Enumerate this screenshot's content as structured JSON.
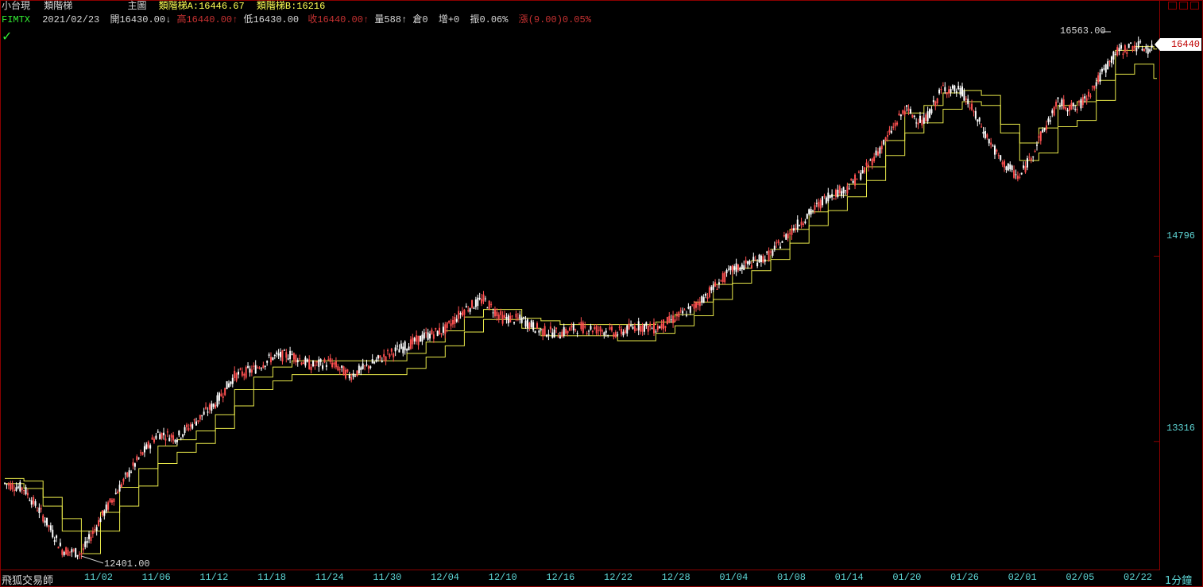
{
  "header": {
    "instrument": "小台現",
    "indicator": "類階梯",
    "panel": "主圖",
    "stairA_label": "類階梯A:",
    "stairA_value": "16446.67",
    "stairB_label": "類階梯B:",
    "stairB_value": "16216"
  },
  "quote": {
    "symbol": "FIMTX",
    "date": "2021/02/23",
    "open_label": "開",
    "open": "16430.00",
    "open_arrow": "↓",
    "high_label": "高",
    "high": "16440.00",
    "high_arrow": "↑",
    "low_label": "低",
    "low": "16430.00",
    "close_label": "收",
    "close": "16440.00",
    "close_arrow": "↑",
    "volume_label": "量",
    "volume": "588",
    "volume_arrow": "↑",
    "oi_label": "倉",
    "oi": "0",
    "oi_change_label": "增",
    "oi_change": "+0",
    "amplitude_label": "振",
    "amplitude": "0.06%",
    "change_label": "漲",
    "change": "(9.00)0.05%"
  },
  "status_icon": "check-icon",
  "price_tag": "16440",
  "footer": {
    "brand": "飛狐交易師",
    "period": "1分鐘"
  },
  "colors": {
    "background": "#000000",
    "border": "#8b0000",
    "stair_line": "#e8e84a",
    "candle_up": "#ffffff",
    "candle_down": "#ff5050",
    "axis_text": "#5fd7d7",
    "header_yellow": "#ffff55",
    "header_green": "#33ee33",
    "header_red": "#c83232"
  },
  "chart_data": {
    "type": "line",
    "title": "",
    "xlabel": "",
    "ylabel": "",
    "ylim": [
      12401,
      16563
    ],
    "y_ticks": [
      "14796",
      "13316"
    ],
    "x_ticks": [
      "11/02",
      "11/06",
      "11/12",
      "11/18",
      "11/24",
      "11/30",
      "12/04",
      "12/10",
      "12/16",
      "12/22",
      "12/28",
      "01/04",
      "01/08",
      "01/14",
      "01/20",
      "01/26",
      "02/01",
      "02/05",
      "02/22"
    ],
    "annotations": [
      {
        "text": "16563.00",
        "kind": "high"
      },
      {
        "text": "12401.00",
        "kind": "low"
      }
    ],
    "x": [
      0,
      1,
      2,
      3,
      4,
      5,
      6,
      7,
      8,
      9,
      10,
      11,
      12,
      13,
      14,
      15,
      16,
      17,
      18,
      19,
      20,
      21,
      22,
      23,
      24,
      25,
      26,
      27,
      28,
      29,
      30,
      31,
      32,
      33,
      34,
      35,
      36,
      37,
      38,
      39,
      40,
      41,
      42,
      43,
      44,
      45,
      46,
      47,
      48,
      49,
      50,
      51,
      52,
      53,
      54,
      55,
      56,
      57,
      58,
      59,
      60
    ],
    "series": [
      {
        "role": "price",
        "values": [
          12980,
          12940,
          12720,
          12450,
          12420,
          12700,
          12950,
          13180,
          13380,
          13350,
          13480,
          13620,
          13840,
          13890,
          13990,
          14010,
          13920,
          13950,
          13840,
          13920,
          14010,
          14080,
          14160,
          14210,
          14370,
          14450,
          14300,
          14290,
          14200,
          14180,
          14230,
          14210,
          14180,
          14240,
          14220,
          14300,
          14390,
          14540,
          14690,
          14740,
          14810,
          14990,
          15130,
          15280,
          15340,
          15500,
          15720,
          15970,
          15860,
          16140,
          16110,
          15830,
          15560,
          15420,
          15720,
          16020,
          15970,
          16180,
          16420,
          16480,
          16440
        ]
      },
      {
        "role": "stair_a",
        "values": [
          13020,
          13000,
          12870,
          12700,
          12600,
          12750,
          12950,
          13100,
          13280,
          13330,
          13400,
          13530,
          13730,
          13830,
          13910,
          13960,
          13960,
          13960,
          13960,
          13960,
          13960,
          14020,
          14110,
          14200,
          14310,
          14370,
          14370,
          14300,
          14280,
          14250,
          14250,
          14250,
          14250,
          14250,
          14270,
          14330,
          14430,
          14570,
          14700,
          14760,
          14850,
          15010,
          15150,
          15280,
          15370,
          15510,
          15720,
          15940,
          16000,
          16100,
          16120,
          16080,
          15850,
          15700,
          15820,
          16000,
          16030,
          16200,
          16440,
          16470,
          16450
        ]
      },
      {
        "role": "stair_b",
        "values": [
          12980,
          12940,
          12800,
          12600,
          12420,
          12600,
          12800,
          12960,
          13140,
          13230,
          13300,
          13420,
          13600,
          13730,
          13800,
          13850,
          13850,
          13850,
          13850,
          13850,
          13850,
          13900,
          13990,
          14080,
          14190,
          14290,
          14290,
          14220,
          14160,
          14160,
          14160,
          14160,
          14120,
          14120,
          14180,
          14240,
          14320,
          14450,
          14580,
          14680,
          14770,
          14900,
          15040,
          15160,
          15270,
          15400,
          15600,
          15780,
          15860,
          15970,
          16030,
          16000,
          15780,
          15560,
          15620,
          15830,
          15880,
          16040,
          16250,
          16330,
          16216
        ]
      }
    ]
  }
}
